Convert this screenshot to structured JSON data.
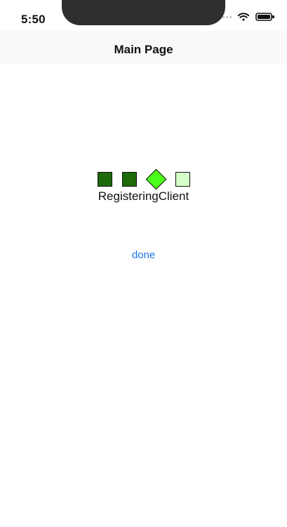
{
  "status": {
    "time": "5:50",
    "icons": {
      "signal": "signal-dots-icon",
      "wifi": "wifi-icon",
      "battery": "battery-icon"
    }
  },
  "nav": {
    "title": "Main Page"
  },
  "main": {
    "indicators": [
      {
        "name": "state-1",
        "shape": "square",
        "color": "#1f6a0a"
      },
      {
        "name": "state-2",
        "shape": "square",
        "color": "#1f6a0a"
      },
      {
        "name": "state-3",
        "shape": "diamond",
        "color": "#4cff1a"
      },
      {
        "name": "state-4",
        "shape": "square",
        "color": "#d7ffc8"
      }
    ],
    "state_label": "RegisteringClient",
    "done_label": "done"
  }
}
